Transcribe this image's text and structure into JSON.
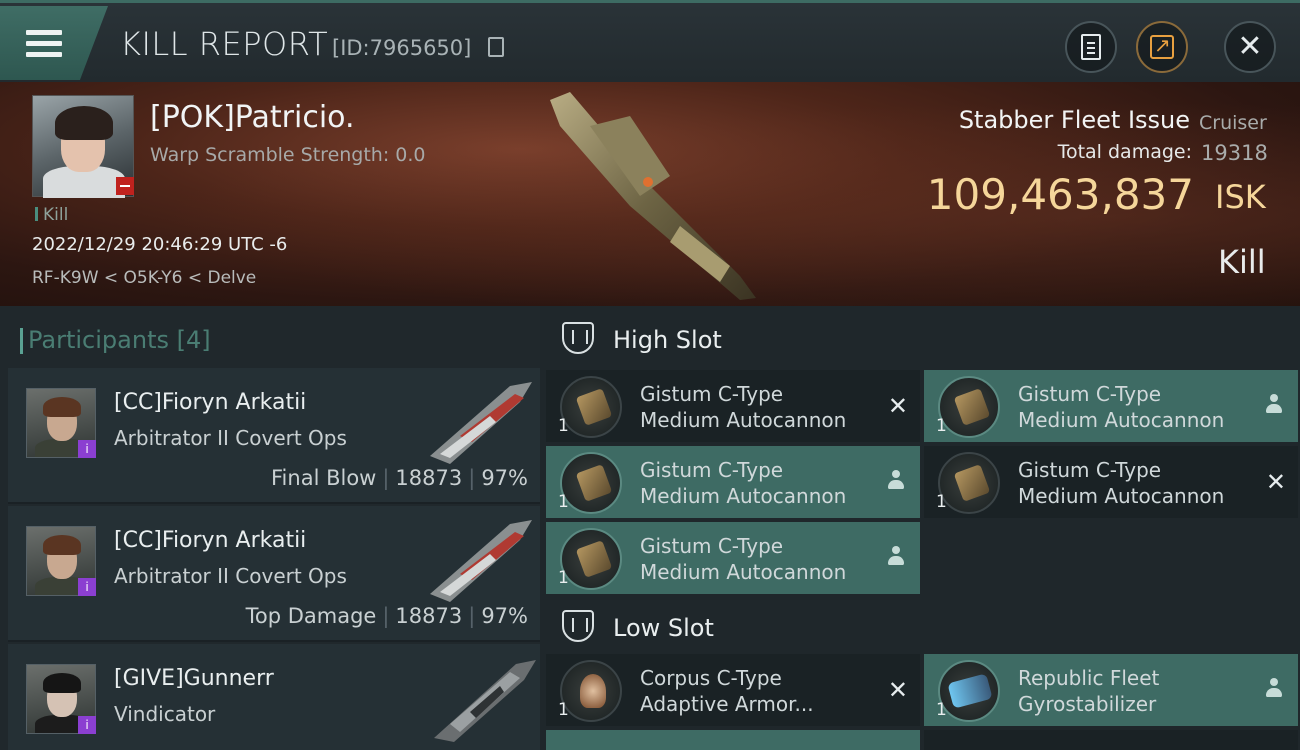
{
  "header": {
    "title": "KILL REPORT",
    "report_id": "[ID:7965650]"
  },
  "victim": {
    "name": "[POK]Patricio.",
    "scramble": "Warp Scramble Strength: 0.0",
    "tag": "Kill",
    "timestamp": "2022/12/29 20:46:29 UTC -6",
    "location": "RF-K9W < O5K-Y6 < Delve",
    "ship_name": "Stabber Fleet Issue",
    "ship_class": "Cruiser",
    "damage_label": "Total damage:",
    "damage_value": "19318",
    "isk_value": "109,463,837",
    "isk_unit": "ISK",
    "result": "Kill"
  },
  "participants": {
    "title": "Participants",
    "count": "[4]",
    "rows": [
      {
        "name": "[CC]Fioryn Arkatii",
        "ship": "Arbitrator II Covert Ops",
        "role": "Final Blow",
        "damage": "18873",
        "pct": "97%"
      },
      {
        "name": "[CC]Fioryn Arkatii",
        "ship": "Arbitrator II Covert Ops",
        "role": "Top Damage",
        "damage": "18873",
        "pct": "97%"
      },
      {
        "name": "[GIVE]Gunnerr",
        "ship": "Vindicator"
      }
    ]
  },
  "fitting": {
    "high_slot_label": "High Slot",
    "low_slot_label": "Low Slot",
    "high": [
      {
        "line1": "Gistum C-Type",
        "line2": "Medium Autocannon",
        "qty": "1",
        "state": "destroyed"
      },
      {
        "line1": "Gistum C-Type",
        "line2": "Medium Autocannon",
        "qty": "1",
        "state": "dropped"
      },
      {
        "line1": "Gistum C-Type",
        "line2": "Medium Autocannon",
        "qty": "1",
        "state": "dropped"
      },
      {
        "line1": "Gistum C-Type",
        "line2": "Medium Autocannon",
        "qty": "1",
        "state": "destroyed"
      },
      {
        "line1": "Gistum C-Type",
        "line2": "Medium Autocannon",
        "qty": "1",
        "state": "dropped"
      }
    ],
    "low": [
      {
        "line1": "Corpus C-Type",
        "line2": "Adaptive Armor...",
        "qty": "1",
        "state": "destroyed"
      },
      {
        "line1": "Republic Fleet",
        "line2": "Gyrostabilizer",
        "qty": "1",
        "state": "dropped"
      }
    ]
  },
  "colors": {
    "accent": "#3e6b64",
    "isk": "#f5d69a",
    "badge_purple": "#8b3fd1",
    "badge_red": "#c0221e"
  }
}
